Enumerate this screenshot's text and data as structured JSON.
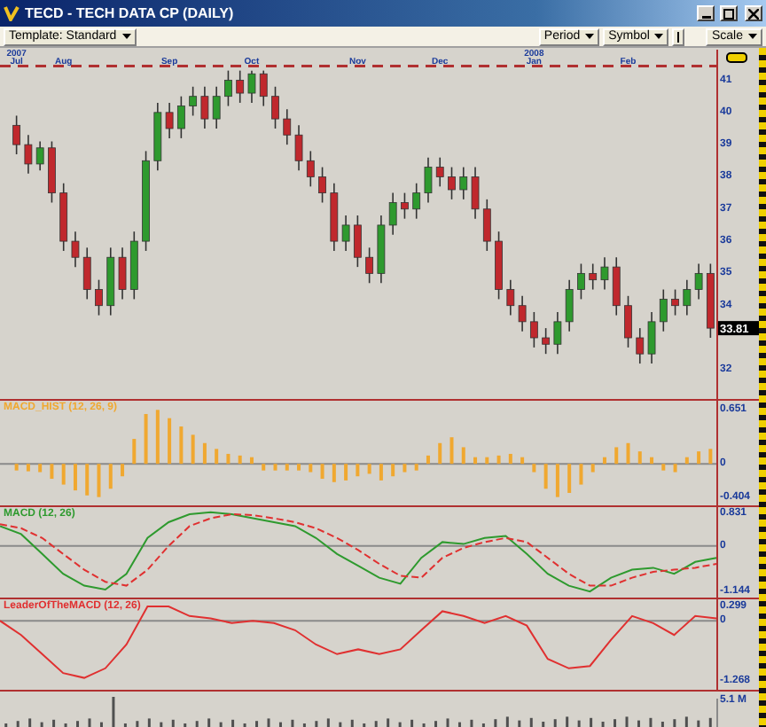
{
  "window": {
    "title": "TECD - TECH DATA CP (DAILY)"
  },
  "toolbar": {
    "template": "Template: Standard",
    "menus": [
      "Period",
      "Symbol"
    ],
    "scale": "Scale"
  },
  "panes": [
    {
      "kind": "price",
      "last_price": "33.81",
      "chart_data": {
        "type": "candlestick",
        "annotations": [
          "2007",
          "2008"
        ],
        "ylim": [
          31.1,
          41.4
        ],
        "yticks": [
          32,
          34,
          35,
          36,
          37,
          38,
          39,
          40,
          41
        ],
        "categories": [
          "Jul",
          null,
          null,
          null,
          "Aug",
          null,
          null,
          null,
          null,
          null,
          null,
          null,
          null,
          "Sep",
          null,
          null,
          null,
          null,
          null,
          null,
          "Oct",
          null,
          null,
          null,
          null,
          null,
          null,
          null,
          null,
          "Nov",
          null,
          null,
          null,
          null,
          null,
          null,
          "Dec",
          null,
          null,
          null,
          null,
          null,
          null,
          null,
          "Jan",
          null,
          null,
          null,
          null,
          null,
          null,
          null,
          "Feb",
          null,
          null,
          null,
          null,
          null,
          null,
          null
        ],
        "ohlc": [
          [
            39.6,
            39.9,
            38.7,
            39
          ],
          [
            39,
            39.3,
            38.1,
            38.4
          ],
          [
            38.4,
            39.1,
            38.2,
            38.9
          ],
          [
            38.9,
            39.1,
            37.2,
            37.5
          ],
          [
            37.5,
            37.8,
            35.7,
            36
          ],
          [
            36,
            36.3,
            35.2,
            35.5
          ],
          [
            35.5,
            35.8,
            34.2,
            34.5
          ],
          [
            34.5,
            34.8,
            33.7,
            34
          ],
          [
            34,
            35.8,
            33.7,
            35.5
          ],
          [
            35.5,
            35.8,
            34.2,
            34.5
          ],
          [
            34.5,
            36.3,
            34.2,
            36
          ],
          [
            36,
            38.8,
            35.7,
            38.5
          ],
          [
            38.5,
            40.3,
            38.2,
            40
          ],
          [
            40,
            40.3,
            39.2,
            39.5
          ],
          [
            39.5,
            40.5,
            39.2,
            40.2
          ],
          [
            40.2,
            40.8,
            39.9,
            40.5
          ],
          [
            40.5,
            40.8,
            39.5,
            39.8
          ],
          [
            39.8,
            40.8,
            39.5,
            40.5
          ],
          [
            40.5,
            41.3,
            40.2,
            41
          ],
          [
            41,
            41.3,
            40.3,
            40.6
          ],
          [
            40.6,
            41.3,
            40.3,
            41.2
          ],
          [
            41.2,
            41.3,
            40.2,
            40.5
          ],
          [
            40.5,
            40.8,
            39.5,
            39.8
          ],
          [
            39.8,
            40.1,
            39,
            39.3
          ],
          [
            39.3,
            39.6,
            38.2,
            38.5
          ],
          [
            38.5,
            38.8,
            37.7,
            38
          ],
          [
            38,
            38.3,
            37.2,
            37.5
          ],
          [
            37.5,
            37.8,
            35.7,
            36
          ],
          [
            36,
            36.8,
            35.7,
            36.5
          ],
          [
            36.5,
            36.8,
            35.2,
            35.5
          ],
          [
            35.5,
            35.8,
            34.7,
            35
          ],
          [
            35,
            36.8,
            34.7,
            36.5
          ],
          [
            36.5,
            37.5,
            36.2,
            37.2
          ],
          [
            37.2,
            37.5,
            36.7,
            37
          ],
          [
            37,
            37.8,
            36.7,
            37.5
          ],
          [
            37.5,
            38.6,
            37.2,
            38.3
          ],
          [
            38.3,
            38.6,
            37.7,
            38
          ],
          [
            38,
            38.3,
            37.3,
            37.6
          ],
          [
            37.6,
            38.3,
            37.3,
            38
          ],
          [
            38,
            38.3,
            36.7,
            37
          ],
          [
            37,
            37.3,
            35.7,
            36
          ],
          [
            36,
            36.3,
            34.2,
            34.5
          ],
          [
            34.5,
            34.8,
            33.7,
            34
          ],
          [
            34,
            34.3,
            33.2,
            33.5
          ],
          [
            33.5,
            33.8,
            32.7,
            33
          ],
          [
            33,
            33.3,
            32.5,
            32.8
          ],
          [
            32.8,
            33.8,
            32.5,
            33.5
          ],
          [
            33.5,
            34.8,
            33.2,
            34.5
          ],
          [
            34.5,
            35.3,
            34.2,
            35
          ],
          [
            35,
            35.3,
            34.5,
            34.8
          ],
          [
            34.8,
            35.5,
            34.5,
            35.2
          ],
          [
            35.2,
            35.5,
            33.7,
            34
          ],
          [
            34,
            34.3,
            32.7,
            33
          ],
          [
            33,
            33.3,
            32.2,
            32.5
          ],
          [
            32.5,
            33.8,
            32.2,
            33.5
          ],
          [
            33.5,
            34.5,
            33.2,
            34.2
          ],
          [
            34.2,
            34.5,
            33.7,
            34
          ],
          [
            34,
            34.8,
            33.7,
            34.5
          ],
          [
            34.5,
            35.3,
            34.2,
            35
          ],
          [
            35,
            35.3,
            33,
            33.3
          ]
        ]
      }
    },
    {
      "kind": "histogram",
      "chart_data": {
        "type": "bar",
        "title": "MACD_HIST (12, 26, 9)",
        "ylim": [
          -0.5,
          0.76
        ],
        "yticks": [
          0.651,
          0,
          -0.404
        ],
        "series": [
          {
            "color": "#f0a830",
            "values": [
              -0.08,
              -0.09,
              -0.1,
              -0.18,
              -0.25,
              -0.32,
              -0.38,
              -0.4,
              -0.3,
              -0.15,
              0.3,
              0.6,
              0.65,
              0.55,
              0.45,
              0.35,
              0.25,
              0.18,
              0.12,
              0.1,
              0.08,
              -0.08,
              -0.08,
              -0.08,
              -0.08,
              -0.1,
              -0.18,
              -0.22,
              -0.2,
              -0.15,
              -0.12,
              -0.2,
              -0.15,
              -0.1,
              -0.08,
              0.1,
              0.25,
              0.32,
              0.2,
              0.08,
              0.08,
              0.1,
              0.12,
              0.08,
              -0.1,
              -0.3,
              -0.4,
              -0.35,
              -0.25,
              -0.1,
              0.08,
              0.2,
              0.25,
              0.15,
              0.08,
              -0.08,
              -0.1,
              0.08,
              0.15,
              0.18
            ]
          }
        ]
      }
    },
    {
      "kind": "indicator",
      "chart_data": {
        "type": "line",
        "title": "MACD (12, 26)",
        "ylim": [
          -1.3,
          0.98
        ],
        "yticks": [
          0.831,
          0,
          -1.144
        ],
        "series": [
          {
            "color": "#2e9a2e",
            "line_style": "solid",
            "values": [
              0.5,
              0.3,
              -0.2,
              -0.7,
              -1.0,
              -1.1,
              -0.7,
              0.2,
              0.6,
              0.8,
              0.85,
              0.8,
              0.7,
              0.6,
              0.5,
              0.2,
              -0.2,
              -0.5,
              -0.8,
              -0.95,
              -0.3,
              0.1,
              0.05,
              0.2,
              0.25,
              -0.2,
              -0.7,
              -1.0,
              -1.15,
              -0.8,
              -0.6,
              -0.55,
              -0.7,
              -0.4,
              -0.3
            ]
          },
          {
            "color": "#e03030",
            "line_style": "dashed",
            "values": [
              0.55,
              0.45,
              0.2,
              -0.2,
              -0.6,
              -0.9,
              -1.0,
              -0.6,
              0.0,
              0.5,
              0.7,
              0.8,
              0.78,
              0.7,
              0.6,
              0.45,
              0.2,
              -0.1,
              -0.45,
              -0.75,
              -0.8,
              -0.3,
              -0.05,
              0.1,
              0.2,
              0.1,
              -0.3,
              -0.7,
              -1.0,
              -1.0,
              -0.8,
              -0.65,
              -0.6,
              -0.55,
              -0.45
            ]
          }
        ]
      }
    },
    {
      "kind": "indicator",
      "chart_data": {
        "type": "line",
        "title": "LeaderOfTheMACD (12, 26)",
        "ylim": [
          -1.45,
          0.45
        ],
        "yticks": [
          0.299,
          0,
          -1.268
        ],
        "series": [
          {
            "color": "#e03030",
            "line_style": "solid",
            "values": [
              0,
              -0.3,
              -0.7,
              -1.1,
              -1.2,
              -1.0,
              -0.5,
              0.3,
              0.3,
              0.1,
              0.05,
              -0.05,
              0,
              -0.05,
              -0.2,
              -0.5,
              -0.7,
              -0.6,
              -0.7,
              -0.6,
              -0.2,
              0.2,
              0.1,
              -0.05,
              0.1,
              -0.1,
              -0.8,
              -1.0,
              -0.95,
              -0.4,
              0.1,
              -0.05,
              -0.3,
              0.1,
              0.05
            ]
          }
        ]
      }
    },
    {
      "kind": "volume",
      "scale_label": "5.1 M"
    }
  ]
}
